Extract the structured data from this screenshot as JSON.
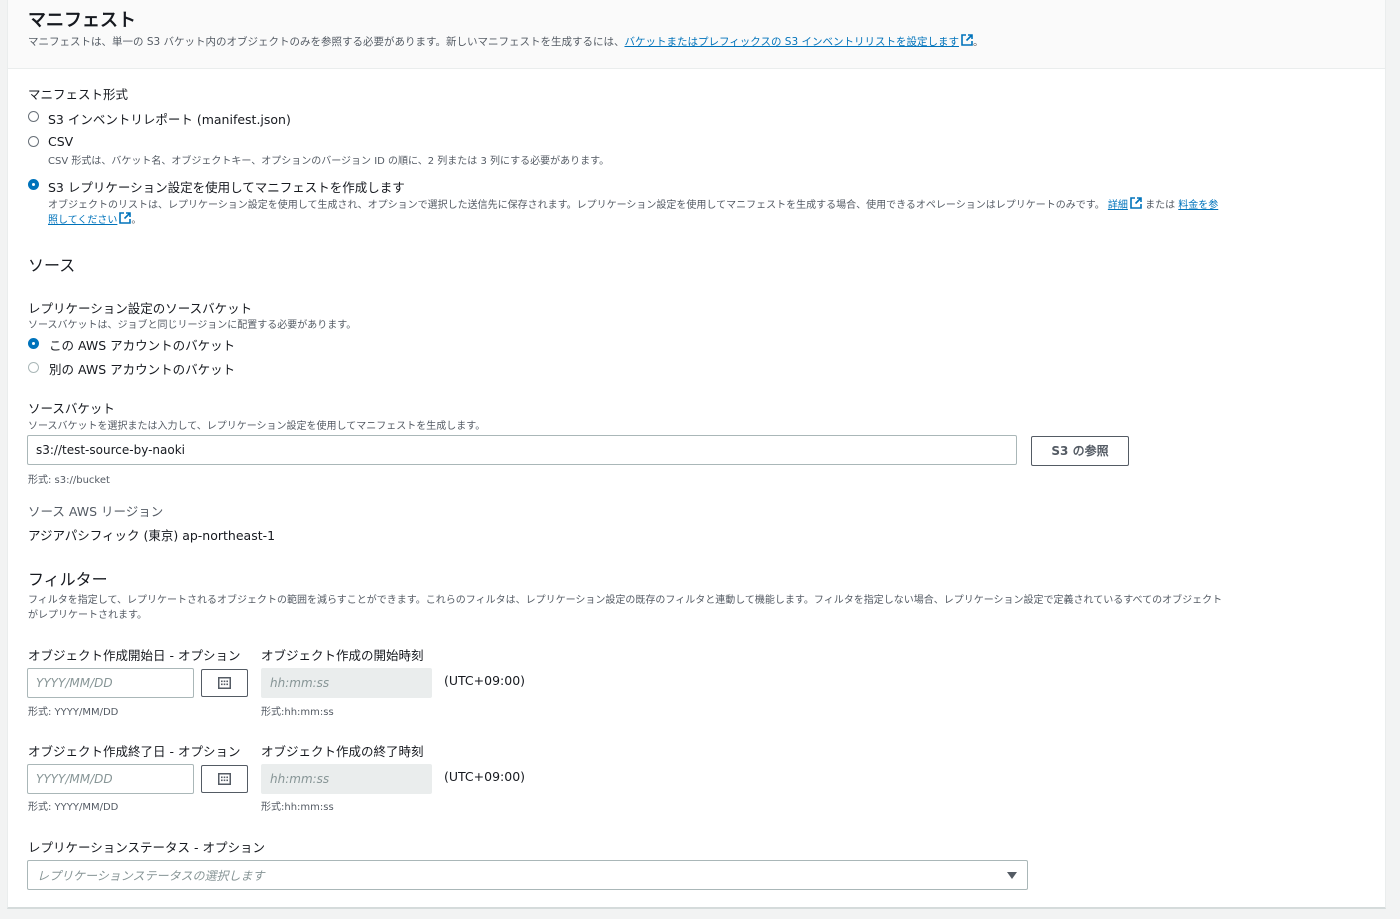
{
  "manifest": {
    "title": "マニフェスト",
    "desc_prefix": "マニフェストは、単一の S3 バケット内のオブジェクトのみを参照する必要があります。新しいマニフェストを生成するには、",
    "desc_link": "バケットまたはプレフィックスの S3 インベントリリストを設定します",
    "desc_suffix": "。",
    "format_label": "マニフェスト形式",
    "options": [
      {
        "label": "S3 インベントリレポート (manifest.json)",
        "checked": false
      },
      {
        "label": "CSV",
        "desc": "CSV 形式は、バケット名、オブジェクトキー、オプションのバージョン ID の順に、2 列または 3 列にする必要があります。",
        "checked": false
      },
      {
        "label": "S3 レプリケーション設定を使用してマニフェストを作成します",
        "desc_line1": "オブジェクトのリストは、レプリケーション設定を使用して生成され、オプションで選択した送信先に保存されます。レプリケーション設定を使用してマニフェストを生成する場合、使用できるオペレーションはレプリケートのみです。",
        "link_detail": "詳細",
        "or_text": "または",
        "link_price_1": "料金を参",
        "link_price_2": "照してください",
        "end": "。",
        "checked": true
      }
    ]
  },
  "source": {
    "title": "ソース",
    "bucket_choice_label": "レプリケーション設定のソースバケット",
    "bucket_choice_sub": "ソースバケットは、ジョブと同じリージョンに配置する必要があります。",
    "choices": [
      {
        "label": "この AWS アカウントのバケット",
        "checked": true
      },
      {
        "label": "別の AWS アカウントのバケット",
        "checked": false
      }
    ],
    "bucket_label": "ソースバケット",
    "bucket_sub": "ソースバケットを選択または入力して、レプリケーション設定を使用してマニフェストを生成します。",
    "bucket_value": "s3://test-source-by-naoki",
    "browse_button": "S3 の参照",
    "bucket_format": "形式: s3://bucket",
    "region_label": "ソース AWS リージョン",
    "region_value": "アジアパシフィック (東京) ap-northeast-1"
  },
  "filter": {
    "title": "フィルター",
    "desc_line1": "フィルタを指定して、レプリケートされるオブジェクトの範囲を減らすことができます。これらのフィルタは、レプリケーション設定の既存のフィルタと連動して機能します。フィルタを指定しない場合、レプリケーション設定で定義されているすべてのオブジェクト",
    "desc_line2": "がレプリケートされます。",
    "start_date_label": "オブジェクト作成開始日 - オプション",
    "start_time_label": "オブジェクト作成の開始時刻",
    "end_date_label": "オブジェクト作成終了日 - オプション",
    "end_time_label": "オブジェクト作成の終了時刻",
    "date_placeholder": "YYYY/MM/DD",
    "time_placeholder": "hh:mm:ss",
    "tz": "(UTC+09:00)",
    "date_format": "形式: YYYY/MM/DD",
    "time_format": "形式:hh:mm:ss",
    "status_label": "レプリケーションステータス - オプション",
    "status_placeholder": "レプリケーションステータスの選択します"
  },
  "colors": {
    "accent": "#0073bb",
    "link": "#0073bb",
    "text": "#16191f",
    "muted": "#545b64"
  }
}
